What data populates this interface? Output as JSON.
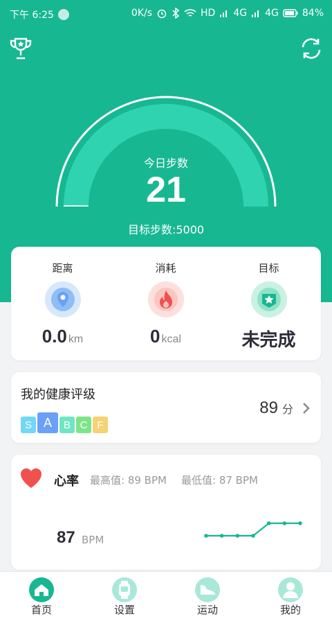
{
  "status_bar": {
    "time": "下午 6:25",
    "speed": "0K/s",
    "net1": "HD",
    "net2": "4G",
    "net3": "4G",
    "battery": "84%"
  },
  "header": {
    "trophy_icon": "trophy-icon",
    "refresh_icon": "refresh-icon",
    "today_label": "今日步数",
    "steps": "21",
    "goal_text": "目标步数:5000",
    "progress_fraction": 0.0042
  },
  "stats": [
    {
      "label": "距离",
      "value": "0.0",
      "unit": "km",
      "icon": "location-pin-icon"
    },
    {
      "label": "消耗",
      "value": "0",
      "unit": "kcal",
      "icon": "flame-icon"
    },
    {
      "label": "目标",
      "value": "未完成",
      "unit": "",
      "icon": "star-badge-icon"
    }
  ],
  "rating": {
    "title": "我的健康评级",
    "grades": [
      "S",
      "A",
      "B",
      "C",
      "F"
    ],
    "selected": "A",
    "score": "89",
    "score_unit": "分"
  },
  "heart": {
    "title": "心率",
    "max": "最高值: 89 BPM",
    "min": "最低值: 87 BPM",
    "value": "87",
    "unit": "BPM",
    "trend": [
      87,
      87,
      87,
      87,
      89,
      89,
      89
    ]
  },
  "tabs": [
    {
      "label": "首页",
      "icon": "home-icon"
    },
    {
      "label": "设置",
      "icon": "watch-icon"
    },
    {
      "label": "运动",
      "icon": "shoe-icon"
    },
    {
      "label": "我的",
      "icon": "user-icon"
    }
  ],
  "colors": {
    "brand": "#17b792",
    "gauge_light": "#2fd3b0",
    "grade_S": "#72d6f7",
    "grade_A": "#6aa0f7",
    "grade_B": "#6ee6c1",
    "grade_C": "#7ee38a",
    "grade_F": "#f7d273",
    "heart": "#f0514f"
  }
}
